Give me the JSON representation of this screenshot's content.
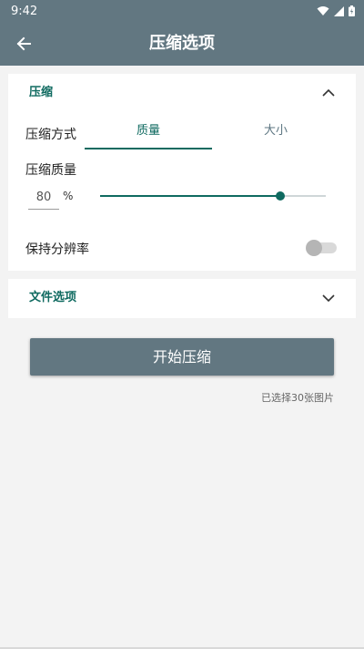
{
  "status_bar": {
    "time": "9:42",
    "icons": [
      "wifi-icon",
      "signal-icon",
      "battery-icon"
    ]
  },
  "app_bar": {
    "title": "压缩选项",
    "back_icon": "arrow-left-icon"
  },
  "compress_section": {
    "title": "压缩",
    "expanded": true,
    "mode_label": "压缩方式",
    "tabs": [
      {
        "label": "质量",
        "selected": true
      },
      {
        "label": "大小",
        "selected": false
      }
    ],
    "quality_label": "压缩质量",
    "quality_value": "80",
    "quality_unit": "%",
    "slider_value": 80,
    "slider_max": 100,
    "keep_resolution_label": "保持分辨率",
    "keep_resolution_enabled": false
  },
  "file_section": {
    "title": "文件选项",
    "expanded": false
  },
  "start_button_label": "开始压缩",
  "selected_count_text": "已选择30张图片",
  "colors": {
    "primary": "#627781",
    "accent": "#0f6a60",
    "background": "#f3f3f3"
  }
}
